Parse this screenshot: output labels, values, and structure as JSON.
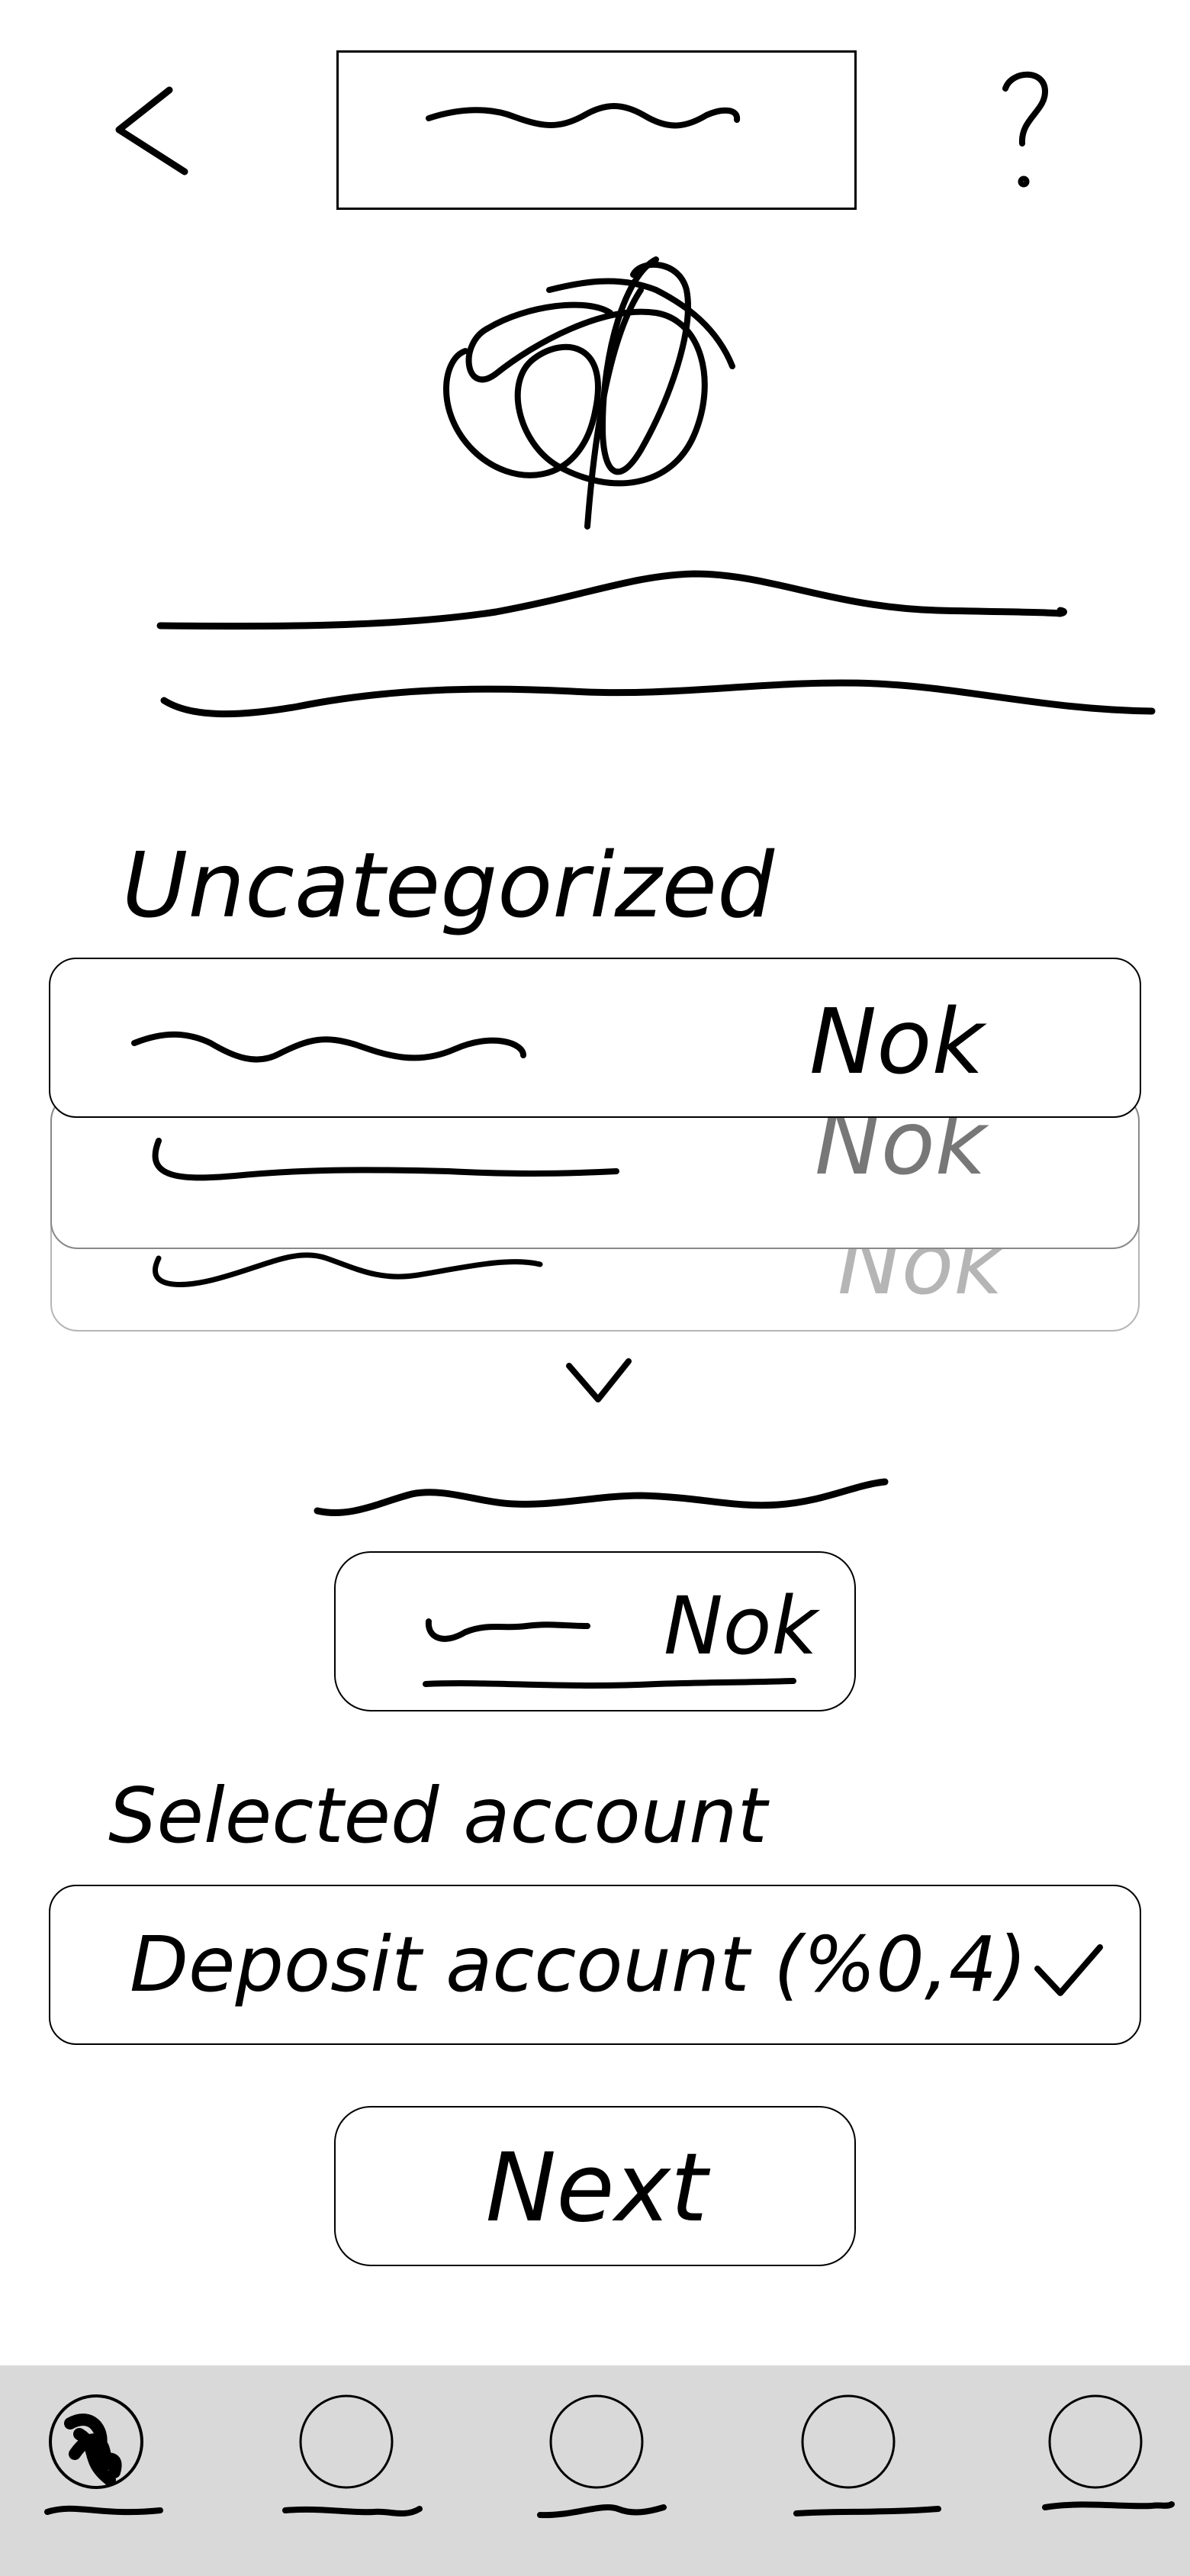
{
  "header": {
    "back_icon": "chevron-left-icon",
    "help_icon": "question-mark-icon"
  },
  "section_label": "Uncategorized",
  "items": [
    {
      "amount": "Nok"
    },
    {
      "amount": "Nok"
    },
    {
      "amount": "Nok"
    }
  ],
  "expand_icon": "chevron-down-icon",
  "selected_item": {
    "amount": "Nok"
  },
  "account": {
    "label": "Selected account",
    "value": "Deposit account (%0,4)",
    "check_icon": "checkmark-icon"
  },
  "next_label": "Next",
  "bottom_nav": {
    "items": [
      {
        "icon": "circle-icon",
        "active": true
      },
      {
        "icon": "circle-icon",
        "active": false
      },
      {
        "icon": "circle-icon",
        "active": false
      },
      {
        "icon": "circle-icon",
        "active": false
      },
      {
        "icon": "circle-icon",
        "active": false
      }
    ]
  },
  "colors": {
    "ink": "#000000",
    "faded_ink": "#777777",
    "lighter_ink": "#b5b5b5",
    "nav_background": "#d9d9d9"
  }
}
